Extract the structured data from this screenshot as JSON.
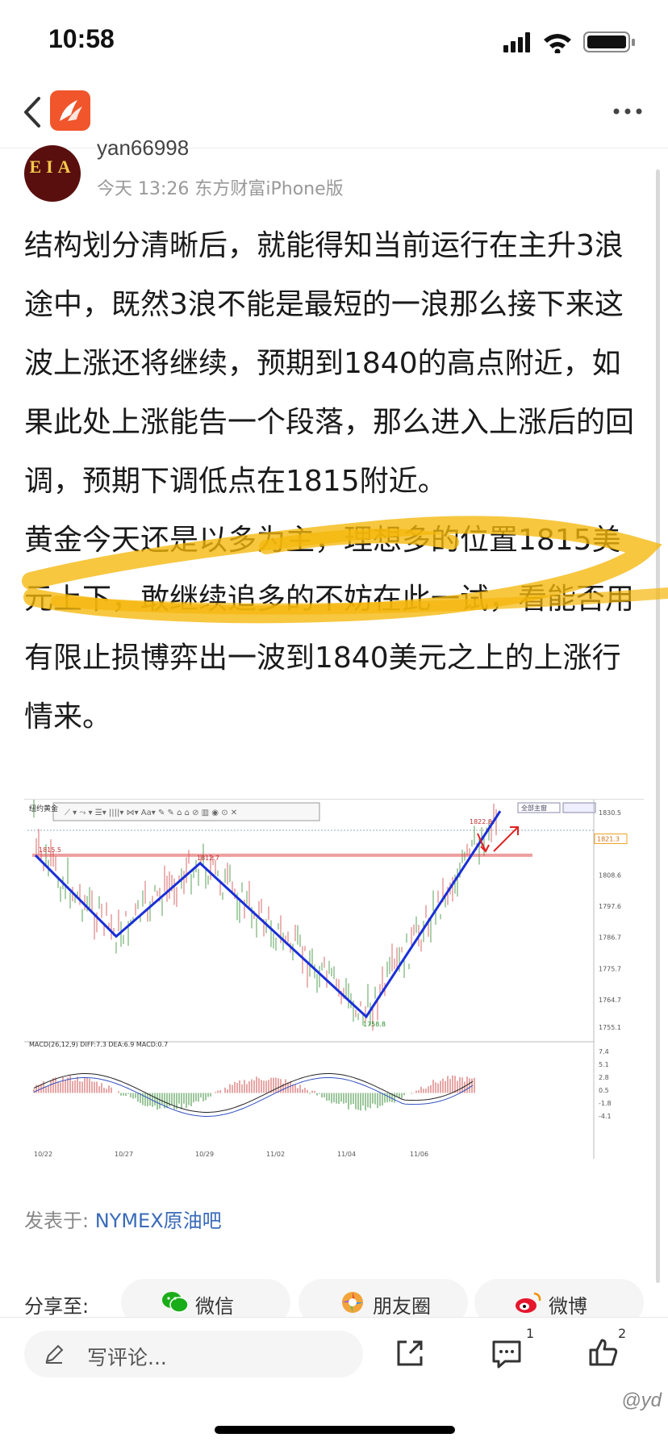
{
  "status_bar": {
    "time": "10:58"
  },
  "author": {
    "avatar_text": "EIA",
    "name": "yan66998",
    "meta": "今天 13:26 东方财富iPhone版"
  },
  "post": {
    "paragraphs": [
      "结构划分清晰后，就能得知当前运行在主升3浪途中，既然3浪不能是最短的一浪那么接下来这波上涨还将继续，预期到1840的高点附近，如果此处上涨能告一个段落，那么进入上涨后的回调，预期下调低点在1815附近。",
      "黄金今天还是以多为主，理想多的位置1815美元上下，敢继续追多的不妨在此一试，看能否用有限止损博弈出一波到1840美元之上的上涨行情来。"
    ],
    "highlight_color": "#f5b70a"
  },
  "chart_data": {
    "type": "line",
    "title": "纽约黄金",
    "x_ticks": [
      "10/22",
      "10/27",
      "10/29",
      "11/02",
      "11/04",
      "11/06"
    ],
    "y_ticks": [
      1830.5,
      1821.3,
      1808.6,
      1797.6,
      1786.7,
      1775.7,
      1764.7,
      1755.1
    ],
    "current_price_label": "1821.3",
    "annotations": [
      "1815.5",
      "1812.7",
      "1758.8",
      "1822.8"
    ],
    "wave_line": [
      {
        "label": "start",
        "y": 1815.5
      },
      {
        "label": "low1",
        "y": 1787
      },
      {
        "label": "high1",
        "y": 1812.7
      },
      {
        "label": "low2",
        "y": 1758.8
      },
      {
        "label": "breakout",
        "y": 1831
      }
    ],
    "horizontal_resistance": 1815.5,
    "toolbar_label": "全部主窗",
    "macd": {
      "label": "MACD(26,12,9) DIFF:7.3 DEA:6.9 MACD:0.7",
      "y_ticks": [
        7.4,
        5.1,
        2.8,
        0.5,
        -1.8,
        -4.1
      ]
    },
    "colors": {
      "wave": "#1a2fd8",
      "resistance": "#e05050",
      "up_candle": "#d76a6a",
      "down_candle": "#5aa05a"
    }
  },
  "footer": {
    "posted_prefix": "发表于: ",
    "forum": "NYMEX原油吧",
    "share_label": "分享至:",
    "share": [
      {
        "label": "微信",
        "icon": "wechat-icon"
      },
      {
        "label": "朋友圈",
        "icon": "moments-icon"
      },
      {
        "label": "微博",
        "icon": "weibo-icon"
      }
    ]
  },
  "bottom_bar": {
    "comment_placeholder": "写评论...",
    "comment_count": "1",
    "like_count": "2"
  },
  "watermark": "@yd"
}
